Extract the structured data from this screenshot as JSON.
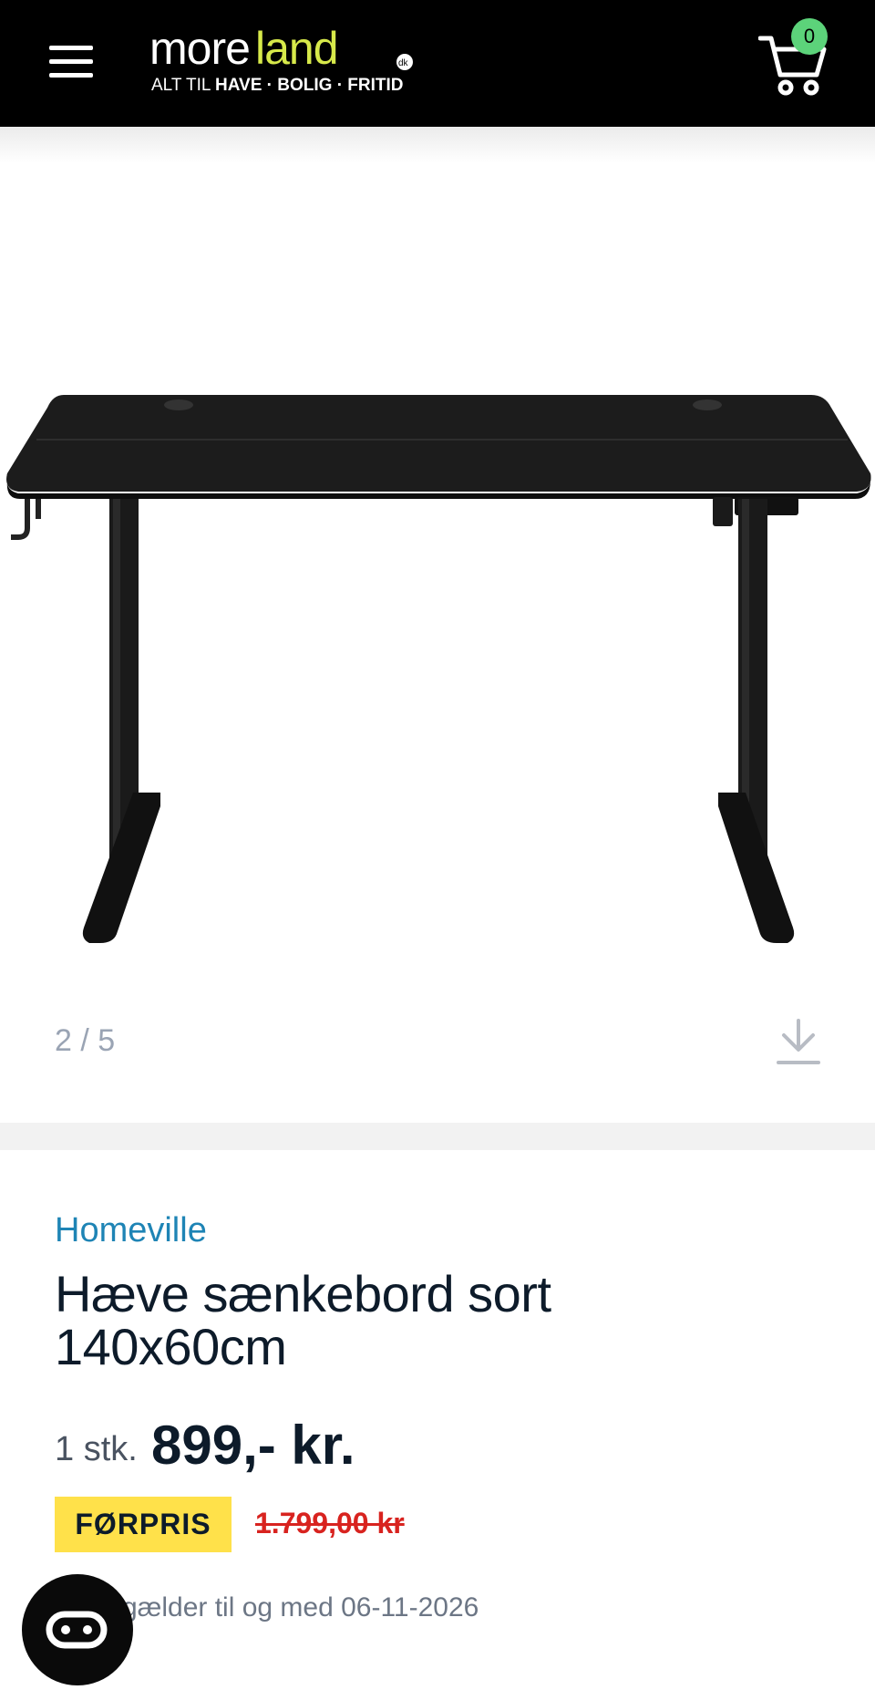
{
  "header": {
    "menu_icon": "hamburger-icon",
    "logo": {
      "word_part1": "more",
      "word_part2": "land",
      "suffix": "dk",
      "tagline_prefix": "ALT TIL",
      "tagline_bold": "HAVE · BOLIG · FRITID"
    },
    "cart_icon": "cart-icon",
    "cart_count": "0",
    "colors": {
      "background": "#000000",
      "logo_accent": "#d7e94a",
      "badge": "#5cd37a"
    }
  },
  "gallery": {
    "counter": "2 / 5",
    "download_icon": "download-icon"
  },
  "product": {
    "brand": "Homeville",
    "title": "Hæve sænkebord sort 140x60cm",
    "unit": "1 stk.",
    "price": "899,- kr.",
    "before_label": "FØRPRIS",
    "before_price": "1.799,00 kr",
    "offer_text": "gælder til og med 06-11-2026",
    "colors": {
      "brand": "#1e84b5",
      "badge": "#ffe14a",
      "old_price": "#d8231f"
    }
  },
  "chat": {
    "icon": "chat-icon"
  }
}
